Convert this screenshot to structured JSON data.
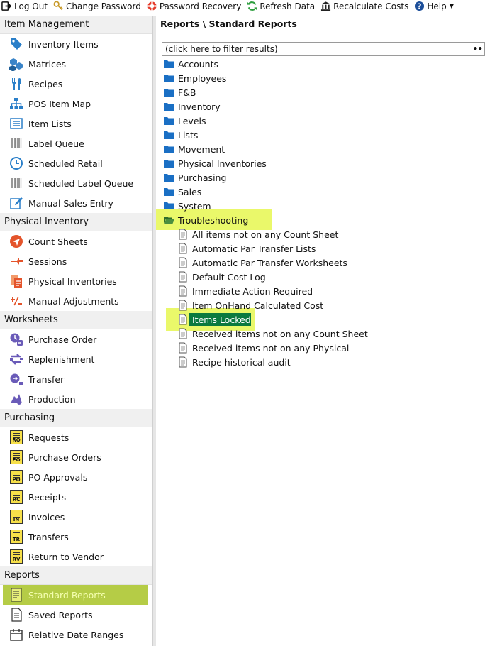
{
  "toolbar": {
    "logout": "Log Out",
    "change_password": "Change Password",
    "password_recovery": "Password Recovery",
    "refresh_data": "Refresh Data",
    "recalculate_costs": "Recalculate Costs",
    "help": "Help"
  },
  "sidebar": {
    "sections": [
      {
        "title": "Item Management",
        "items": [
          {
            "label": "Inventory Items",
            "icon": "tag-icon"
          },
          {
            "label": "Matrices",
            "icon": "cubes-icon"
          },
          {
            "label": "Recipes",
            "icon": "utensils-icon"
          },
          {
            "label": "POS Item Map",
            "icon": "sitemap-icon"
          },
          {
            "label": "Item Lists",
            "icon": "list-icon"
          },
          {
            "label": "Label Queue",
            "icon": "barcode-icon"
          },
          {
            "label": "Scheduled Retail",
            "icon": "clock-icon"
          },
          {
            "label": "Scheduled Label Queue",
            "icon": "barcode-icon"
          },
          {
            "label": "Manual Sales Entry",
            "icon": "edit-icon"
          }
        ]
      },
      {
        "title": "Physical Inventory",
        "items": [
          {
            "label": "Count Sheets",
            "icon": "send-icon"
          },
          {
            "label": "Sessions",
            "icon": "sessions-icon"
          },
          {
            "label": "Physical Inventories",
            "icon": "documents-icon"
          },
          {
            "label": "Manual Adjustments",
            "icon": "plus-minus-icon"
          }
        ]
      },
      {
        "title": "Worksheets",
        "items": [
          {
            "label": "Purchase Order",
            "icon": "purchase-order-icon"
          },
          {
            "label": "Replenishment",
            "icon": "replenishment-icon"
          },
          {
            "label": "Transfer",
            "icon": "transfer-icon"
          },
          {
            "label": "Production",
            "icon": "production-icon"
          }
        ]
      },
      {
        "title": "Purchasing",
        "items": [
          {
            "label": "Requests",
            "badge": "RQ"
          },
          {
            "label": "Purchase Orders",
            "badge": "PO"
          },
          {
            "label": "PO Approvals",
            "badge": "PO"
          },
          {
            "label": "Receipts",
            "badge": "RC"
          },
          {
            "label": "Invoices",
            "badge": "IN"
          },
          {
            "label": "Transfers",
            "badge": "TR"
          },
          {
            "label": "Return to Vendor",
            "badge": "RV"
          }
        ]
      },
      {
        "title": "Reports",
        "items": [
          {
            "label": "Standard Reports",
            "icon": "report-icon",
            "selected": true
          },
          {
            "label": "Saved Reports",
            "icon": "saved-report-icon"
          },
          {
            "label": "Relative Date Ranges",
            "icon": "calendar-icon"
          }
        ]
      }
    ]
  },
  "main": {
    "breadcrumb": "Reports \\ Standard Reports",
    "filter_placeholder": "(click here to filter results)",
    "folders": [
      "Accounts",
      "Employees",
      "F&B",
      "Inventory",
      "Levels",
      "Lists",
      "Movement",
      "Physical Inventories",
      "Purchasing",
      "Sales",
      "System"
    ],
    "open_folder": "Troubleshooting",
    "reports": [
      "All items not on any Count Sheet",
      "Automatic Par Transfer Lists",
      "Automatic Par Transfer Worksheets",
      "Default Cost Log",
      "Immediate Action Required",
      "Item OnHand Calculated Cost",
      "Items Locked",
      "Received items not on any Count Sheet",
      "Received items not on any Physical",
      "Recipe historical audit"
    ],
    "selected_report": "Items Locked"
  },
  "colors": {
    "folder": "#1a6fc4",
    "selection": "#0b7a3f",
    "highlight": "#eaf86a",
    "sidebar_selected": "#b5cc46"
  }
}
